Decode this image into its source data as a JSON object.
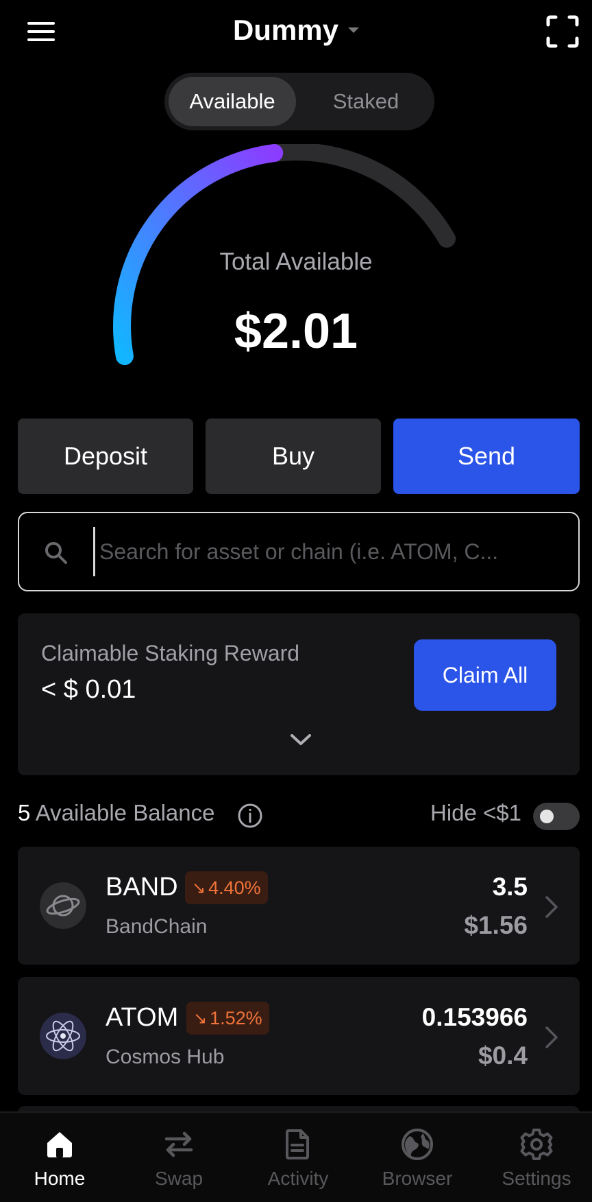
{
  "header": {
    "title": "Dummy",
    "menu_icon": "hamburger-menu-icon",
    "scan_icon": "scan-frame-icon"
  },
  "tabs": {
    "available": "Available",
    "staked": "Staked",
    "selected": "Available"
  },
  "gauge": {
    "label": "Total Available",
    "value": "$2.01",
    "fill_fraction": 0.58,
    "color_start": "#12b6ff",
    "color_end": "#8b3dff",
    "track_color": "#2c2c2e"
  },
  "actions": {
    "deposit": "Deposit",
    "buy": "Buy",
    "send": "Send"
  },
  "search": {
    "placeholder": "Search for asset or chain (i.e. ATOM, C...",
    "value": ""
  },
  "reward": {
    "label": "Claimable Staking Reward",
    "value": "< $ 0.01",
    "claim_label": "Claim All"
  },
  "balances": {
    "count": "5",
    "title": "Available Balance",
    "hide_label": "Hide <$1",
    "hide_enabled": false,
    "assets": [
      {
        "symbol": "BAND",
        "change": "4.40%",
        "chain": "BandChain",
        "amount": "3.5",
        "usd": "$1.56",
        "icon": "band-planet-icon"
      },
      {
        "symbol": "ATOM",
        "change": "1.52%",
        "chain": "Cosmos Hub",
        "amount": "0.153966",
        "usd": "$0.4",
        "icon": "cosmos-atom-icon"
      }
    ]
  },
  "nav": {
    "home": "Home",
    "swap": "Swap",
    "activity": "Activity",
    "browser": "Browser",
    "settings": "Settings",
    "active": "Home"
  },
  "colors": {
    "accent": "#2b54e8",
    "negative": "#f0743a",
    "card": "#151517"
  }
}
